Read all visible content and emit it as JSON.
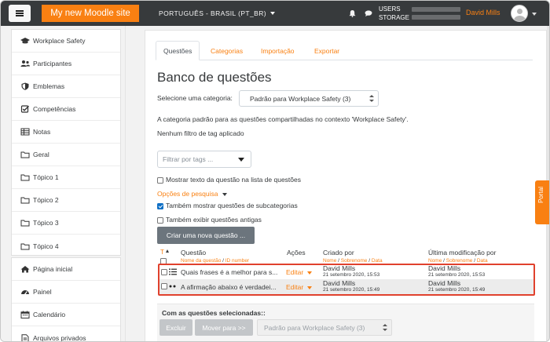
{
  "navbar": {
    "site_name": "My new Moodle site",
    "language": "PORTUGUÊS - BRASIL (PT_BR)",
    "stats_users": "USERS",
    "stats_storage": "STORAGE",
    "user_name": "David Mills"
  },
  "sidebar": {
    "items": [
      {
        "label": "Workplace Safety",
        "icon": "graduation-cap-icon"
      },
      {
        "label": "Participantes",
        "icon": "users-icon"
      },
      {
        "label": "Emblemas",
        "icon": "shield-icon"
      },
      {
        "label": "Competências",
        "icon": "check-square-icon"
      },
      {
        "label": "Notas",
        "icon": "table-icon"
      },
      {
        "label": "Geral",
        "icon": "folder-icon"
      },
      {
        "label": "Tópico 1",
        "icon": "folder-icon"
      },
      {
        "label": "Tópico 2",
        "icon": "folder-icon"
      },
      {
        "label": "Tópico 3",
        "icon": "folder-icon"
      },
      {
        "label": "Tópico 4",
        "icon": "folder-icon"
      }
    ],
    "items2": [
      {
        "label": "Página inicial",
        "icon": "home-icon"
      },
      {
        "label": "Painel",
        "icon": "dashboard-icon"
      },
      {
        "label": "Calendário",
        "icon": "calendar-icon"
      },
      {
        "label": "Arquivos privados",
        "icon": "file-icon"
      }
    ]
  },
  "tabs": [
    "Questões",
    "Categorias",
    "Importação",
    "Exportar"
  ],
  "page_title": "Banco de questões",
  "category": {
    "label": "Selecione uma categoria:",
    "value": "Padrão para Workplace Safety (3)",
    "description": "A categoria padrão para as questões compartilhadas no contexto 'Workplace Safety'.",
    "tag_filter_status": "Nenhum filtro de tag aplicado",
    "tag_filter_placeholder": "Filtrar por tags ..."
  },
  "options": {
    "show_text": "Mostrar texto da questão na lista de questões",
    "search_options": "Opções de pesquisa",
    "show_subcategories": "Também mostrar questões de subcategorias",
    "show_old": "Também exibir questões antigas",
    "create_button": "Criar uma nova questão ..."
  },
  "table": {
    "sort_t": "T",
    "col_question": "Questão",
    "col_question_sub_name": "Nome da questão",
    "col_question_sub_id": "ID number",
    "col_actions": "Ações",
    "col_created": "Criado por",
    "col_modified": "Última modificação por",
    "sub_first": "Nome",
    "sub_last": "Sobrenome",
    "sub_date": "Data",
    "slash": "/",
    "rows": [
      {
        "name": "Quais frases é a melhor para s...",
        "action": "Editar",
        "created_by": "David Mills",
        "created_date": "21 setembro 2020, 15:53",
        "modified_by": "David Mills",
        "modified_date": "21 setembro 2020, 15:53",
        "type_icon": "multichoice-list-icon"
      },
      {
        "name": "A afirmação abaixo é verdadei...",
        "action": "Editar",
        "created_by": "David Mills",
        "created_date": "21 setembro 2020, 15:49",
        "modified_by": "David Mills",
        "modified_date": "21 setembro 2020, 15:49",
        "type_icon": "truefalse-dots-icon"
      }
    ]
  },
  "bulk": {
    "title": "Com as questões selecionadas::",
    "delete": "Excluir",
    "move": "Mover para >>",
    "target": "Padrão para Workplace Safety (3)"
  },
  "portal_label": "Portal",
  "colors": {
    "navbar": "#373a3c",
    "brand": "#f98012",
    "link": "#f98012",
    "highlight": "#e0412d"
  }
}
